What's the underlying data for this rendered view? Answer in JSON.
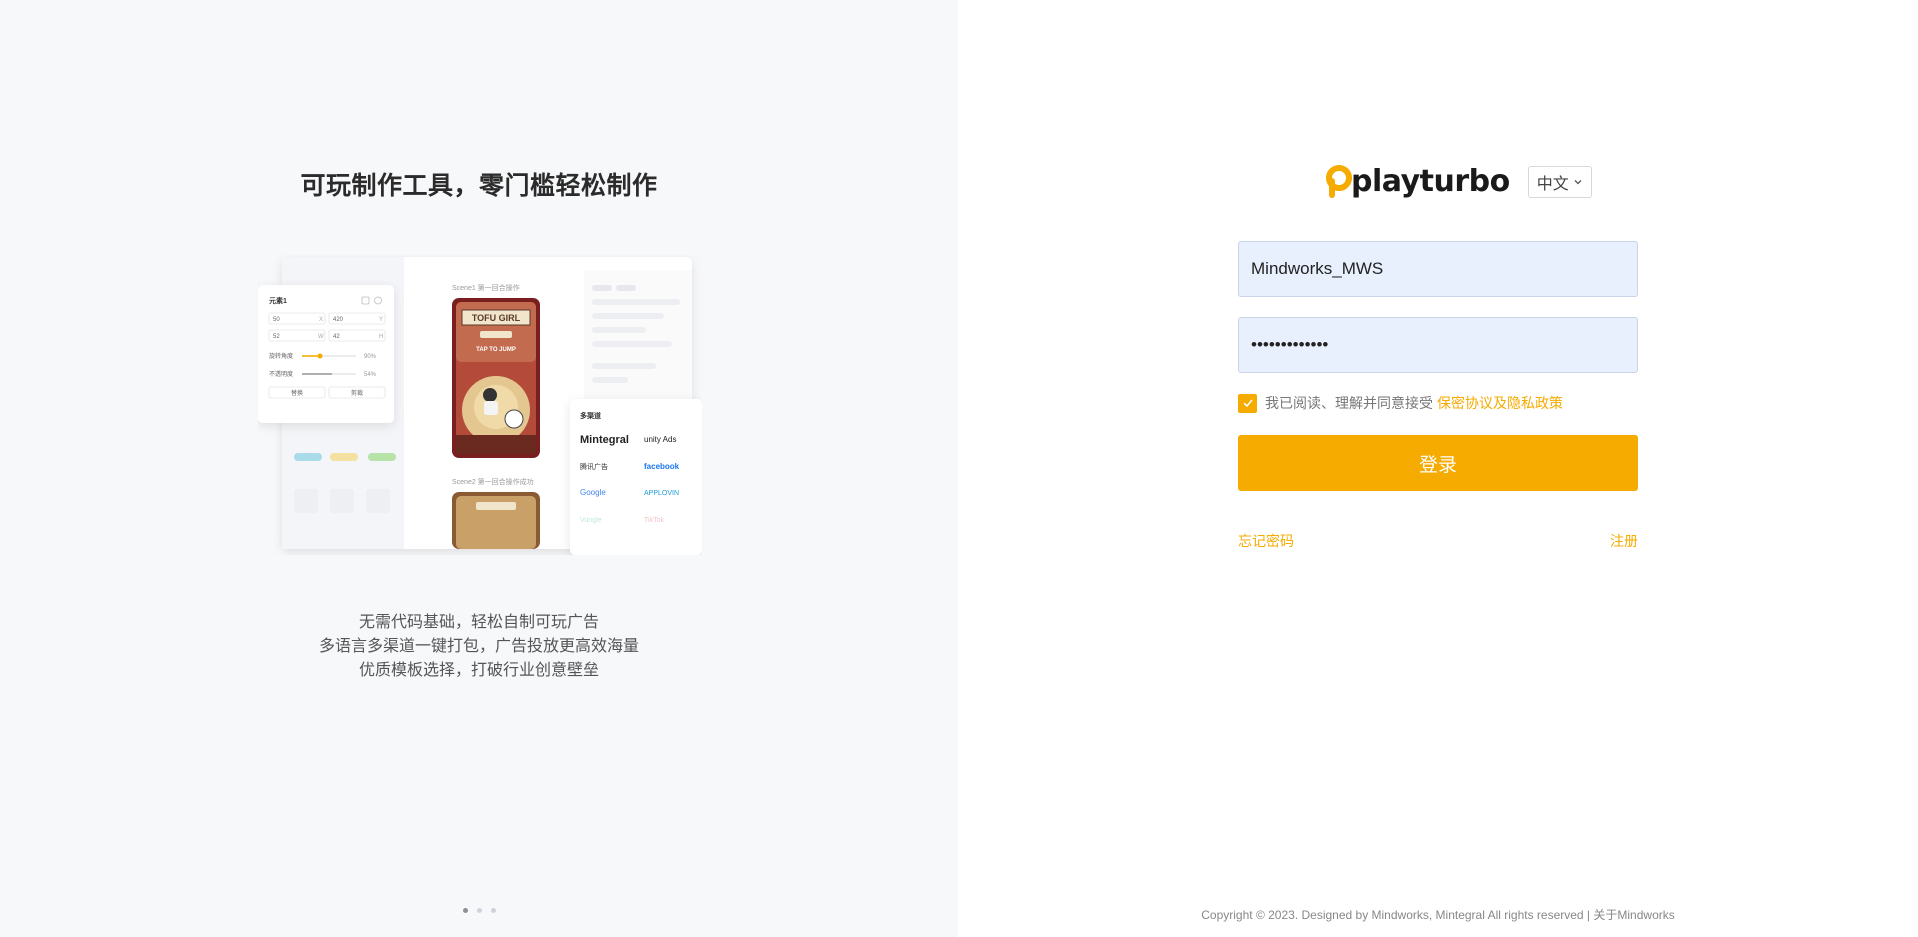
{
  "left": {
    "title": "可玩制作工具，零门槛轻松制作",
    "desc": [
      "无需代码基础，轻松自制可玩广告",
      "多语言多渠道一键打包，广告投放更高效海量",
      "优质模板选择，打破行业创意壁垒"
    ],
    "carousel": {
      "count": 3,
      "active": 0
    },
    "showcase": {
      "panel_title": "元素1",
      "x_value": "50",
      "x_label": "X",
      "y_value": "420",
      "y_label": "Y",
      "w_value": "52",
      "w_label": "W",
      "h_value": "42",
      "h_label": "H",
      "rotation_label": "旋转角度",
      "rotation_value": "90%",
      "opacity_label": "不透明度",
      "opacity_value": "54%",
      "btn_left": "替换",
      "btn_right": "剪裁",
      "scene1_label": "Scene1 第一回合操作",
      "scene2_label": "Scene2 第一回合操作成功",
      "game_title": "TOFU GIRL",
      "game_cta": "TAP TO JUMP",
      "channels_title": "多渠道",
      "channels": [
        "Mintegral",
        "unity Ads",
        "腾讯广告",
        "facebook",
        "Google",
        "APPLOVIN",
        "Vungle",
        "TikTok"
      ]
    }
  },
  "right": {
    "logo_text": "playturbo",
    "language": "中文",
    "username": "Mindworks_MWS",
    "password": "•••••••••••••",
    "agree_text": "我已阅读、理解并同意接受",
    "policy_link": "保密协议及隐私政策",
    "login_label": "登录",
    "forgot_label": "忘记密码",
    "register_label": "注册",
    "copyright_text": "Copyright © 2023. Designed by Mindworks, Mintegral All rights reserved | ",
    "about_link": "关于Mindworks"
  },
  "colors": {
    "accent": "#f5ab00",
    "input_bg": "#e8f0fe",
    "left_bg": "#f7f8fa"
  }
}
